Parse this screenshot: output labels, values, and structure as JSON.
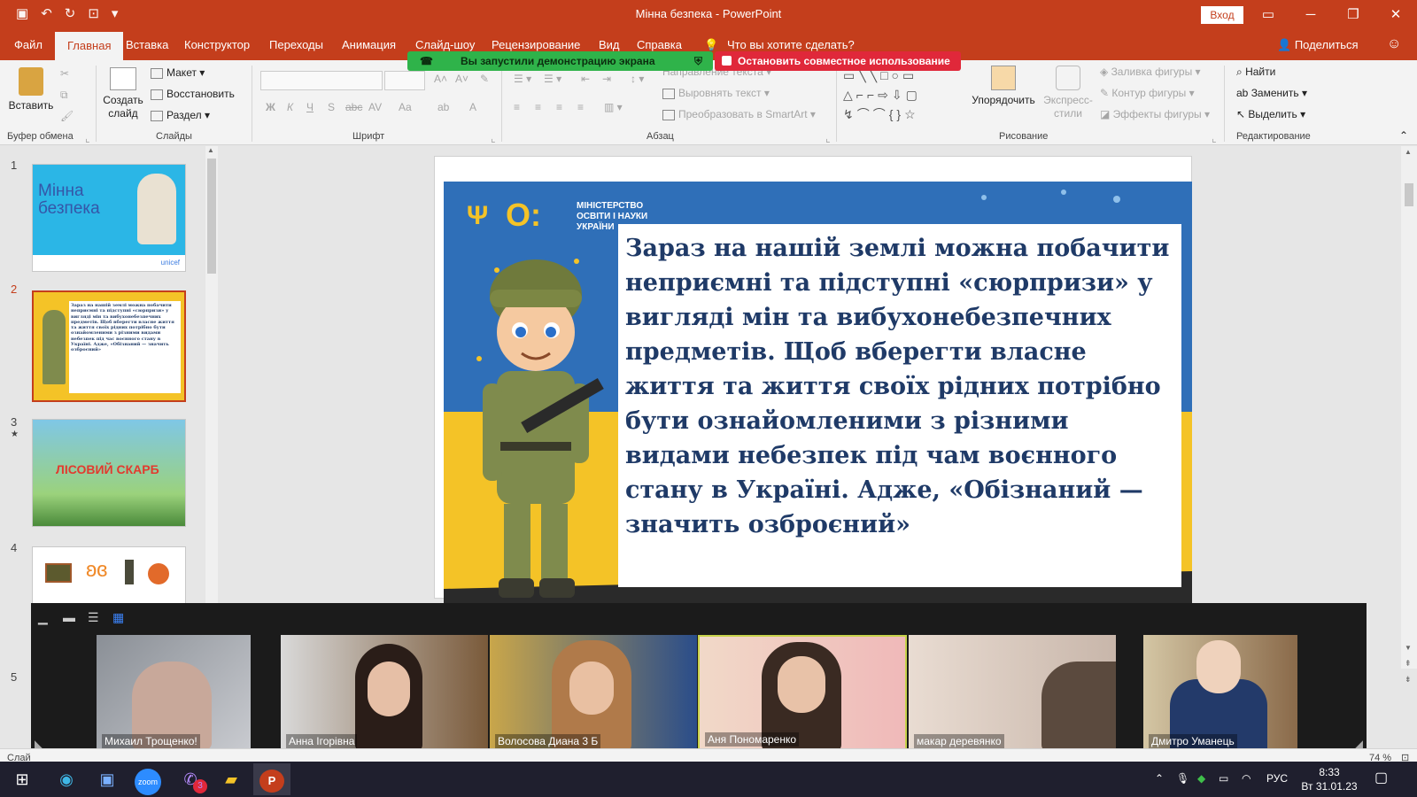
{
  "window": {
    "title": "Мінна безпека  -  PowerPoint",
    "login_label": "Вход",
    "share_label": "Поделиться",
    "tell_me": "Что вы хотите сделать?"
  },
  "tabs": [
    "Файл",
    "Главная",
    "Вставка",
    "Конструктор",
    "Переходы",
    "Анимация",
    "Слайд-шоу",
    "Рецензирование",
    "Вид",
    "Справка"
  ],
  "active_tab": "Главная",
  "banners": {
    "demo": "Вы запустили демонстрацию экрана",
    "stop": "Остановить совместное использование"
  },
  "ribbon": {
    "clipboard": {
      "paste": "Вставить",
      "label": "Буфер обмена"
    },
    "slides": {
      "new_slide": "Создать слайд",
      "layout": "Макет",
      "reset": "Восстановить",
      "section": "Раздел",
      "label": "Слайды"
    },
    "font": {
      "label": "Шрифт",
      "bold": "Ж",
      "italic": "К",
      "underline": "Ч",
      "strike": "S"
    },
    "paragraph": {
      "label": "Абзац",
      "text_direction": "Направление текста",
      "align_text": "Выровнять текст",
      "smartart": "Преобразовать в SmartArt"
    },
    "drawing": {
      "label": "Рисование",
      "arrange": "Упорядочить",
      "quick_styles": "Экспресс-стили",
      "fill": "Заливка фигуры",
      "outline": "Контур фигуры",
      "effects": "Эффекты фигуры"
    },
    "editing": {
      "label": "Редактирование",
      "find": "Найти",
      "replace": "Заменить",
      "select": "Выделить"
    }
  },
  "thumbnails": [
    {
      "num": "1",
      "title": "Мінна безпека",
      "footer": "unicef"
    },
    {
      "num": "2",
      "text": "Зараз на нашій землі можна побачити неприємні та підступні «сюрпризи» у вигляді мін та вибухонебезпечних предметів. Щоб вберегти власне життя та життя своїх рідних потрібно бути ознайомленими з різними видами небезпек під час воєнного стану в Україні. Адже, «Обізнаний — значить озброєний»"
    },
    {
      "num": "3",
      "title": "ЛІСОВИЙ СКАРБ"
    },
    {
      "num": "4"
    },
    {
      "num": "5"
    }
  ],
  "slide": {
    "ministry": [
      "МІНІСТЕРСТВО",
      "ОСВІТИ І НАУКИ",
      "УКРАЇНИ"
    ],
    "text": "Зараз на нашій землі можна побачити неприємні та підступні «сюрпризи» у вигляді мін та вибухонебезпечних предметів. Щоб вберегти власне життя та життя своїх рідних потрібно бути ознайомленими з різними видами небезпек під чам воєнного стану в Україні. Адже, «Обізнаний — значить озброєний»"
  },
  "participants": [
    "Михаил Трощенко!",
    "Анна Ігорівна",
    "Волосова Диана 3 Б",
    "Аня Пономаренко",
    "макар  деревянко",
    "Дмитро Уманець"
  ],
  "status": {
    "left": "Слай",
    "zoom": "74 %"
  },
  "taskbar": {
    "lang": "РУС",
    "time": "8:33",
    "date": "Вт 31.01.23",
    "viber_badge": "3",
    "zoom_label": "zoom"
  },
  "colors": {
    "accent": "#c43e1c",
    "green": "#2fb34a",
    "red": "#e0283a",
    "slide_text": "#1f3a67"
  }
}
